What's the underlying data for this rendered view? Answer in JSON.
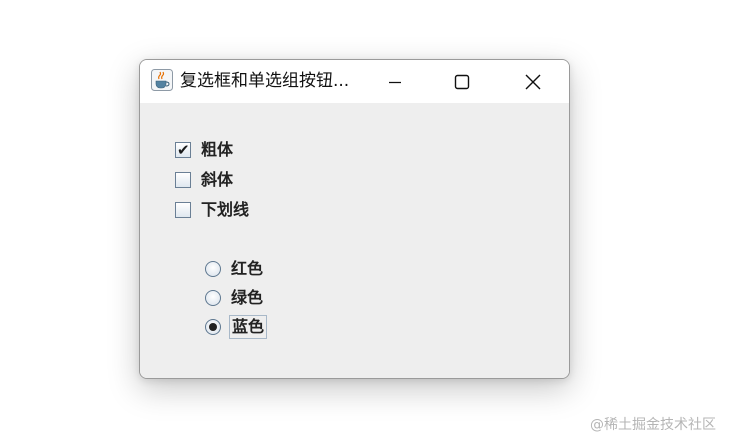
{
  "window": {
    "title": "复选框和单选组按钮..."
  },
  "checkboxes": [
    {
      "label": "粗体",
      "checked": true
    },
    {
      "label": "斜体",
      "checked": false
    },
    {
      "label": "下划线",
      "checked": false
    }
  ],
  "radios": [
    {
      "label": "红色",
      "selected": false
    },
    {
      "label": "绿色",
      "selected": false
    },
    {
      "label": "蓝色",
      "selected": true
    }
  ],
  "icons": {
    "app": "java-cup-icon",
    "minimize": "minimize-icon",
    "maximize": "maximize-icon",
    "close": "close-icon",
    "checkmark": "checkmark-icon"
  },
  "watermark": "@稀土掘金技术社区"
}
